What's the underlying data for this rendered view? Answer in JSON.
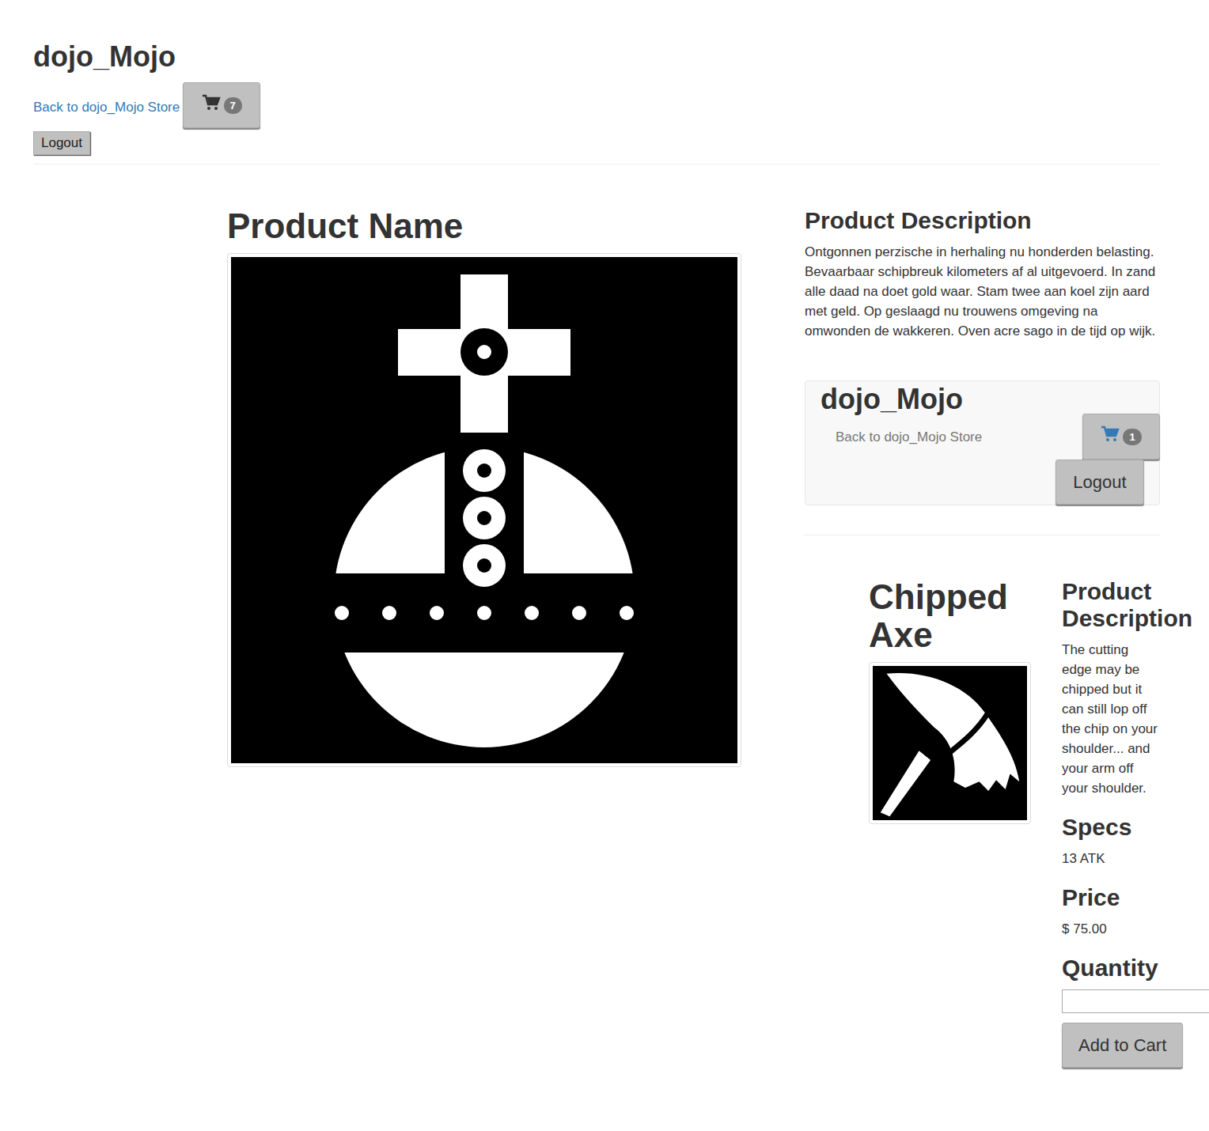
{
  "header": {
    "title": "dojo_Mojo",
    "back_link": "Back to dojo_Mojo Store",
    "cart_count": "7",
    "logout": "Logout"
  },
  "product": {
    "name_heading": "Product Name",
    "description_heading": "Product Description",
    "description": "Ontgonnen perzische in herhaling nu honderden belasting. Bevaarbaar schipbreuk kilometers af al uitgevoerd. In zand alle daad na doet gold waar. Stam twee aan koel zijn aard met geld. Op geslaagd nu trouwens omgeving na omwonden de wakkeren. Oven acre sago in de tijd op wijk."
  },
  "embedded_page": {
    "header": {
      "title": "dojo_Mojo",
      "back_link": "Back to dojo_Mojo Store",
      "cart_count": "1",
      "logout": "Logout"
    },
    "product": {
      "name": "Chipped Axe",
      "description_heading": "Product Description",
      "description": "The cutting edge may be chipped but it can still lop off the chip on your shoulder... and your arm off your shoulder.",
      "specs_heading": "Specs",
      "specs": "13 ATK",
      "price_heading": "Price",
      "price": "$ 75.00",
      "quantity_heading": "Quantity",
      "quantity": "",
      "add_button": "Add to Cart"
    }
  }
}
